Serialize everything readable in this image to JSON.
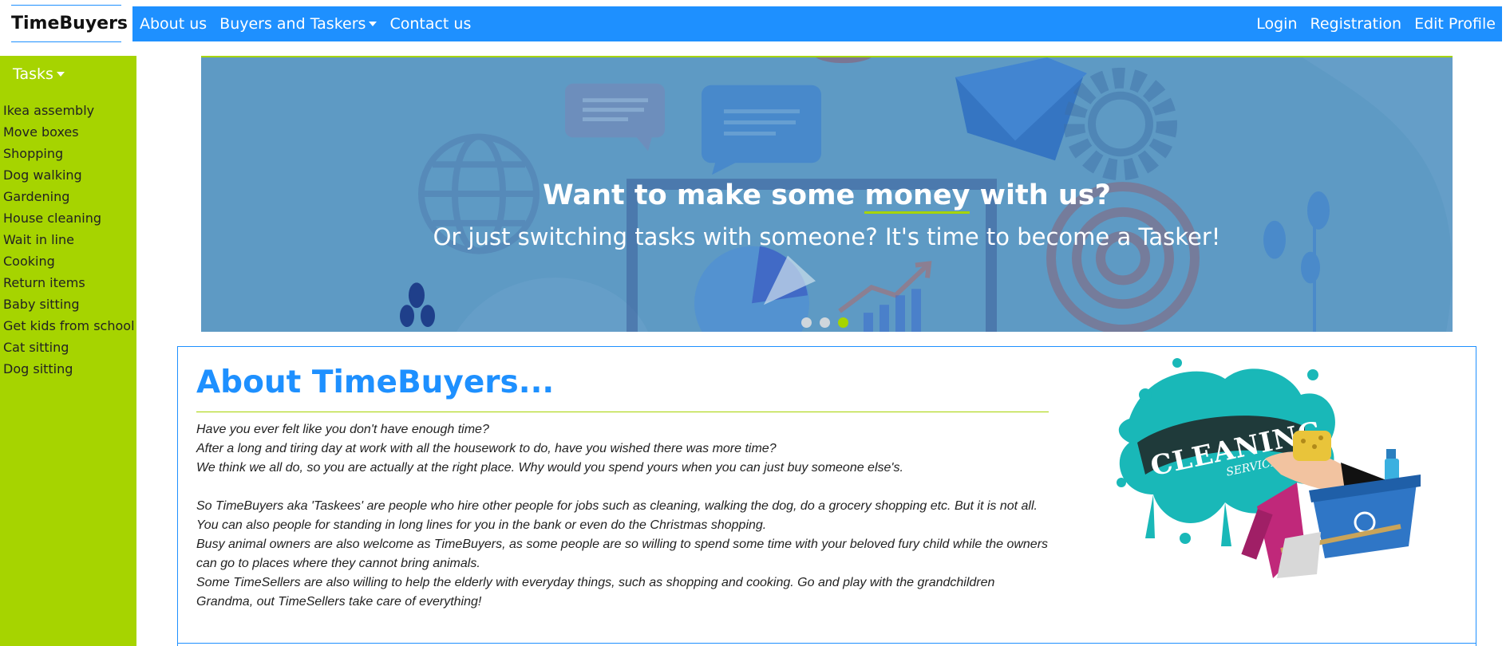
{
  "brand": "TimeBuyers",
  "nav": {
    "about": "About us",
    "buyers_taskers": "Buyers and Taskers",
    "contact": "Contact us",
    "login": "Login",
    "registration": "Registration",
    "edit_profile": "Edit Profile"
  },
  "sidebar": {
    "toggle": "Tasks",
    "items": [
      "Ikea assembly",
      "Move boxes",
      "Shopping",
      "Dog walking",
      "Gardening",
      "House cleaning",
      "Wait in line",
      "Cooking",
      "Return items",
      "Baby sitting",
      "Get kids from school",
      "Cat sitting",
      "Dog sitting"
    ]
  },
  "carousel": {
    "title_before": "Want to make some ",
    "title_highlight": "money",
    "title_after": " with us?",
    "subtitle": "Or just switching tasks with someone? It's time to become a Tasker!",
    "slide_count": 3,
    "active_slide": 3
  },
  "about": {
    "title": "About TimeBuyers...",
    "lines": [
      "Have you ever felt like you don't have enough time?",
      "After a long and tiring day at work with all the housework to do, have you wished there was more time?",
      "We think we all do, so you are actually at the right place. Why would you spend yours when you can just buy someone else's.",
      "",
      "So TimeBuyers aka 'Taskees' are people who hire other people for jobs such as cleaning, walking the dog, do a grocery shopping etc. But it is not all. You can also people for standing in long lines for you in the bank or even do the Christmas shopping.",
      "Busy animal owners are also welcome as TimeBuyers, as some people are so willing to spend some time with your beloved fury child while the owners can go to places where they cannot bring animals.",
      "Some TimeSellers are also willing to help the elderly with everyday things, such as shopping and cooking. Go and play with the grandchildren Grandma, out TimeSellers take care of everything!"
    ],
    "image_text_main": "CLEANING",
    "image_text_sub": "SERVICE"
  },
  "colors": {
    "primary": "#1e90ff",
    "accent": "#a6d400",
    "carousel_bg": "#5e9ac4"
  }
}
